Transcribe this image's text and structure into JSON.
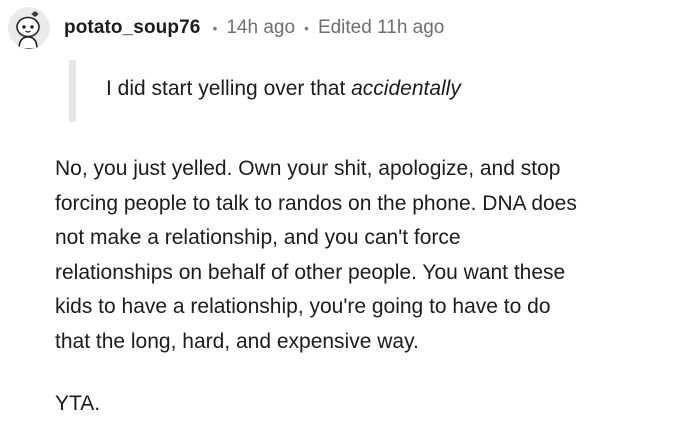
{
  "comment": {
    "author": "potato_soup76",
    "separator": "•",
    "posted": "14h ago",
    "edited": "Edited 11h ago",
    "quote": {
      "text_before": "I did start yelling over that ",
      "text_italic": "accidentally"
    },
    "body_lines": [
      "No, you just yelled. Own your shit, apologize, and stop",
      "forcing people to talk to randos on the phone. DNA does",
      "not make a relationship, and you can't force",
      "relationships on behalf of other people. You want these",
      "kids to have a relationship, you're going to have to do",
      "that the long, hard, and expensive way."
    ],
    "verdict": "YTA."
  },
  "colors": {
    "text": "#1c1c1c",
    "meta": "#6f6f6f",
    "quote_bar": "#e6e6e6",
    "avatar_bg": "#e9eaeb"
  },
  "icons": {
    "avatar": "snoo-avatar-icon"
  }
}
